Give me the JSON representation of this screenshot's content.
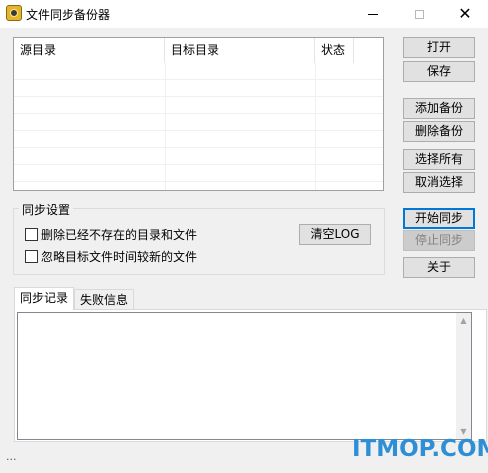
{
  "window": {
    "title": "文件同步备份器",
    "close_glyph": "✕"
  },
  "list": {
    "columns": [
      "源目录",
      "目标目录",
      "状态"
    ]
  },
  "buttons": {
    "open": "打开",
    "save": "保存",
    "add_backup": "添加备份",
    "delete_backup": "删除备份",
    "select_all": "选择所有",
    "deselect": "取消选择",
    "start_sync": "开始同步",
    "stop_sync": "停止同步",
    "about": "关于",
    "clear_log": "清空LOG"
  },
  "sync_settings": {
    "label": "同步设置",
    "delete_missing": {
      "label": "删除已经不存在的目录和文件",
      "checked": false
    },
    "ignore_newer": {
      "label": "忽略目标文件时间较新的文件",
      "checked": false
    }
  },
  "tabs": [
    "同步记录",
    "失败信息"
  ],
  "status_bar": {
    "text": "..."
  },
  "watermark": {
    "text": "ITMOP.COM"
  },
  "colors": {
    "accent": "#0078d7",
    "watermark": "#2e8fd6"
  }
}
